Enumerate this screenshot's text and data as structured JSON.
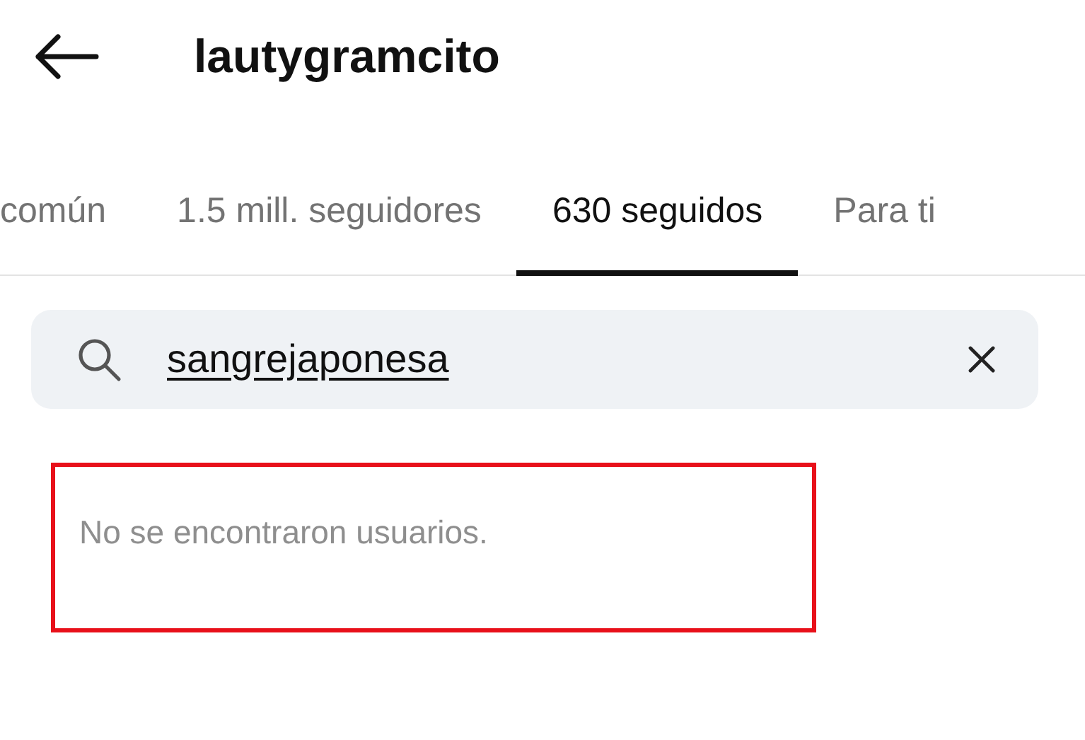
{
  "header": {
    "title": "lautygramcito"
  },
  "tabs": [
    {
      "label": "común",
      "selected": false
    },
    {
      "label": "1.5 mill. seguidores",
      "selected": false
    },
    {
      "label": "630 seguidos",
      "selected": true
    },
    {
      "label": "Para ti",
      "selected": false
    }
  ],
  "search": {
    "value": "sangrejaponesa"
  },
  "results": {
    "message": "No se encontraron usuarios.",
    "highlighted": true
  }
}
